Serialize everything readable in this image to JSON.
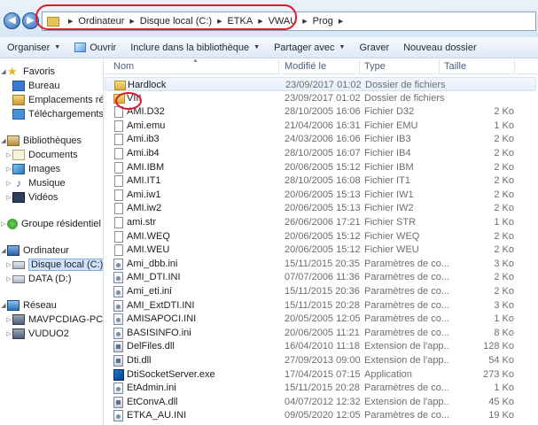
{
  "address": {
    "crumbs": [
      "Ordinateur",
      "Disque local (C:)",
      "ETKA",
      "VWAU",
      "Prog"
    ]
  },
  "toolbar": {
    "organize": "Organiser",
    "open": "Ouvrir",
    "include_library": "Inclure dans la bibliothèque",
    "share": "Partager avec",
    "burn": "Graver",
    "new_folder": "Nouveau dossier"
  },
  "nav": {
    "favorites": "Favoris",
    "desktop": "Bureau",
    "recent_places": "Emplacements récents",
    "downloads": "Téléchargements",
    "libraries": "Bibliothèques",
    "documents": "Documents",
    "images": "Images",
    "music": "Musique",
    "videos": "Vidéos",
    "homegroup": "Groupe résidentiel",
    "computer": "Ordinateur",
    "local_disk": "Disque local (C:)",
    "data_drive": "DATA (D:)",
    "network": "Réseau",
    "net_pc1": "MAVPCDIAG-PC",
    "net_pc2": "VUDUO2"
  },
  "columns": {
    "name": "Nom",
    "modified": "Modifié le",
    "type": "Type",
    "size": "Taille"
  },
  "files": [
    {
      "name": "Hardlock",
      "date": "23/09/2017 01:02",
      "type": "Dossier de fichiers",
      "size": "",
      "icon": "folder-icon"
    },
    {
      "name": "VIII",
      "date": "23/09/2017 01:02",
      "type": "Dossier de fichiers",
      "size": "",
      "icon": "folder-icon"
    },
    {
      "name": "AMI.D32",
      "date": "28/10/2005 16:06",
      "type": "Fichier D32",
      "size": "2 Ko",
      "icon": "file-icon"
    },
    {
      "name": "Ami.emu",
      "date": "21/04/2006 16:31",
      "type": "Fichier EMU",
      "size": "1 Ko",
      "icon": "file-icon"
    },
    {
      "name": "Ami.ib3",
      "date": "24/03/2006 16:06",
      "type": "Fichier IB3",
      "size": "2 Ko",
      "icon": "file-icon"
    },
    {
      "name": "Ami.ib4",
      "date": "28/10/2005 16:07",
      "type": "Fichier IB4",
      "size": "2 Ko",
      "icon": "file-icon"
    },
    {
      "name": "AMI.IBM",
      "date": "20/06/2005 15:12",
      "type": "Fichier IBM",
      "size": "2 Ko",
      "icon": "file-icon"
    },
    {
      "name": "AMI.IT1",
      "date": "28/10/2005 16:08",
      "type": "Fichier IT1",
      "size": "2 Ko",
      "icon": "file-icon"
    },
    {
      "name": "Ami.iw1",
      "date": "20/06/2005 15:13",
      "type": "Fichier IW1",
      "size": "2 Ko",
      "icon": "file-icon"
    },
    {
      "name": "AMI.iw2",
      "date": "20/06/2005 15:13",
      "type": "Fichier IW2",
      "size": "2 Ko",
      "icon": "file-icon"
    },
    {
      "name": "ami.str",
      "date": "26/06/2006 17:21",
      "type": "Fichier STR",
      "size": "1 Ko",
      "icon": "file-icon"
    },
    {
      "name": "AMI.WEQ",
      "date": "20/06/2005 15:12",
      "type": "Fichier WEQ",
      "size": "2 Ko",
      "icon": "file-icon"
    },
    {
      "name": "AMI.WEU",
      "date": "20/06/2005 15:12",
      "type": "Fichier WEU",
      "size": "2 Ko",
      "icon": "file-icon"
    },
    {
      "name": "Ami_dbb.ini",
      "date": "15/11/2015 20:35",
      "type": "Paramètres de co...",
      "size": "3 Ko",
      "icon": "settings-file-icon"
    },
    {
      "name": "AMI_DTI.INI",
      "date": "07/07/2006 11:36",
      "type": "Paramètres de co...",
      "size": "2 Ko",
      "icon": "settings-file-icon"
    },
    {
      "name": "Ami_eti.ini",
      "date": "15/11/2015 20:36",
      "type": "Paramètres de co...",
      "size": "2 Ko",
      "icon": "settings-file-icon"
    },
    {
      "name": "AMI_ExtDTI.INI",
      "date": "15/11/2015 20:28",
      "type": "Paramètres de co...",
      "size": "3 Ko",
      "icon": "settings-file-icon"
    },
    {
      "name": "AMISAPOCI.INI",
      "date": "20/05/2005 12:05",
      "type": "Paramètres de co...",
      "size": "1 Ko",
      "icon": "settings-file-icon"
    },
    {
      "name": "BASISINFO.ini",
      "date": "20/06/2005 11:21",
      "type": "Paramètres de co...",
      "size": "8 Ko",
      "icon": "settings-file-icon"
    },
    {
      "name": "DelFiles.dll",
      "date": "16/04/2010 11:18",
      "type": "Extension de l'app...",
      "size": "128 Ko",
      "icon": "dll-icon"
    },
    {
      "name": "Dti.dll",
      "date": "27/09/2013 09:00",
      "type": "Extension de l'app...",
      "size": "54 Ko",
      "icon": "dll-icon"
    },
    {
      "name": "DtiSocketServer.exe",
      "date": "17/04/2015 07:15",
      "type": "Application",
      "size": "273 Ko",
      "icon": "exe-icon"
    },
    {
      "name": "EtAdmin.ini",
      "date": "15/11/2015 20:28",
      "type": "Paramètres de co...",
      "size": "1 Ko",
      "icon": "settings-file-icon"
    },
    {
      "name": "EtConvA.dll",
      "date": "04/07/2012 12:32",
      "type": "Extension de l'app...",
      "size": "45 Ko",
      "icon": "dll-icon"
    },
    {
      "name": "ETKA_AU.INI",
      "date": "09/05/2020 12:05",
      "type": "Paramètres de co...",
      "size": "19 Ko",
      "icon": "settings-file-icon"
    }
  ],
  "annotation_color": "#e0192c"
}
